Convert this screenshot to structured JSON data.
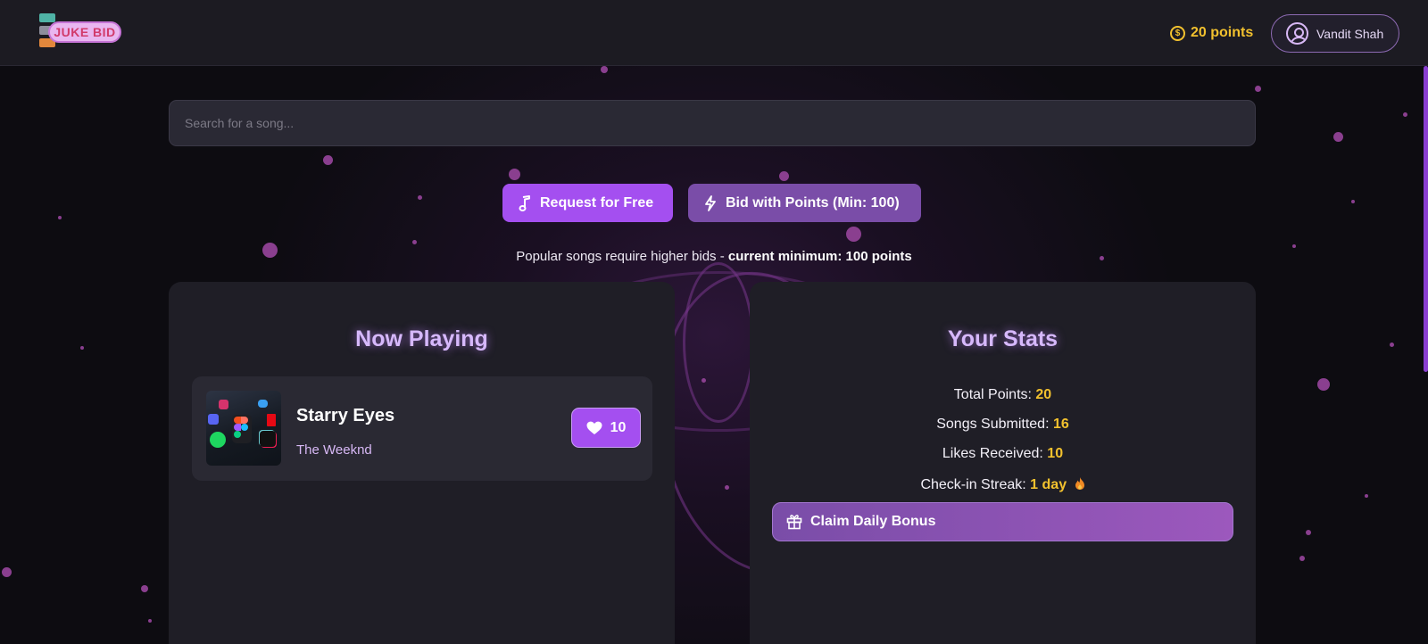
{
  "header": {
    "logo_text": "JUKE BID",
    "points_label": "20 points",
    "user_name": "Vandit Shah"
  },
  "search": {
    "placeholder": "Search for a song..."
  },
  "actions": {
    "request_free_label": "Request for Free",
    "bid_label": "Bid with Points (Min: 100)",
    "hint_prefix": "Popular songs require higher bids - ",
    "hint_bold": "current minimum: 100 points"
  },
  "now_playing": {
    "title": "Now Playing",
    "song": {
      "title": "Starry Eyes",
      "artist": "The Weeknd",
      "likes": "10"
    }
  },
  "stats": {
    "title": "Your Stats",
    "total_points_label": "Total Points:",
    "total_points_value": "20",
    "songs_submitted_label": "Songs Submitted:",
    "songs_submitted_value": "16",
    "likes_received_label": "Likes Received:",
    "likes_received_value": "10",
    "streak_label": "Check-in Streak:",
    "streak_value": "1 day",
    "claim_label": "Claim Daily Bonus"
  },
  "colors": {
    "accent": "#a44ff0",
    "accent_muted": "#7a4da8",
    "points_gold": "#f2c12e",
    "title_glow": "#d6b8fb",
    "background": "#0d0c11"
  },
  "icons": [
    "dollar-coin-icon",
    "user-circle-icon",
    "music-note-icon",
    "lightning-icon",
    "heart-icon",
    "gift-icon",
    "flame-icon"
  ]
}
